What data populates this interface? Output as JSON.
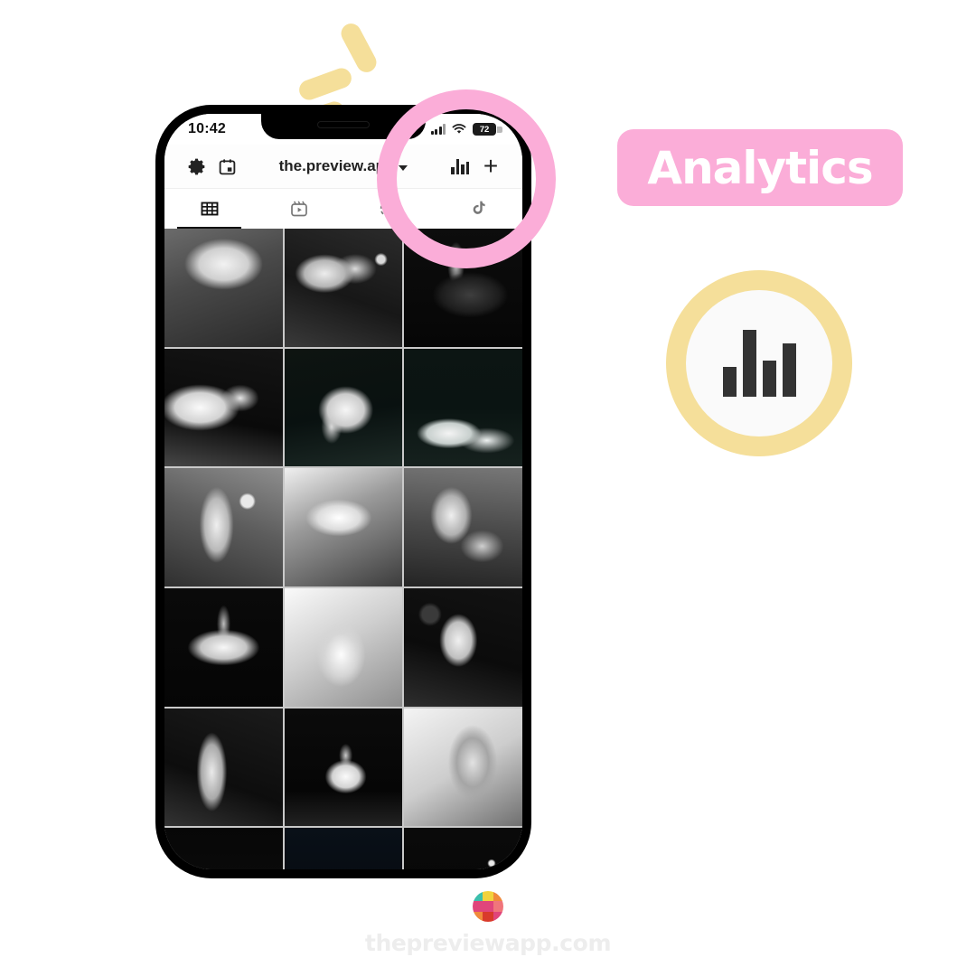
{
  "canvas": {
    "background": "#ffffff",
    "accent_pink": "#FBADD8",
    "accent_yellow": "#F5DF9A",
    "watermark_gray": "#EDEDED"
  },
  "confetti": [
    {
      "name": "confetti-dash-1"
    },
    {
      "name": "confetti-dash-2"
    },
    {
      "name": "confetti-dash-3"
    }
  ],
  "phone": {
    "status_bar": {
      "time": "10:42",
      "signal_icon": "cellular-signal-icon",
      "wifi_icon": "wifi-icon",
      "battery_level": "72"
    },
    "toolbar": {
      "settings_icon": "gear-icon",
      "calendar_icon": "calendar-icon",
      "account_name": "the.preview.app",
      "account_chevron": "chevron-down-icon",
      "analytics_icon": "bar-chart-icon",
      "add_icon": "plus-icon",
      "add_label": "+"
    },
    "tabs": [
      {
        "name": "tab-grid",
        "icon": "grid-icon",
        "active": true
      },
      {
        "name": "tab-reels",
        "icon": "reels-icon",
        "active": false
      },
      {
        "name": "tab-stories",
        "icon": "circle-dashed-icon",
        "active": false
      },
      {
        "name": "tab-tiktok",
        "icon": "tiktok-icon",
        "active": false
      }
    ],
    "grid": {
      "columns": 3,
      "theme": "black-and-white ballet photography",
      "cells": [
        {
          "label": "ballerina in tutu bending forward"
        },
        {
          "label": "row of ballerinas backstage"
        },
        {
          "label": "ballerina in dark tutu on pointe"
        },
        {
          "label": "group of ballerinas in white tutus"
        },
        {
          "label": "pas de deux lift on stage"
        },
        {
          "label": "two white tutus hanging"
        },
        {
          "label": "close-up of pointe shoes on toes"
        },
        {
          "label": "dancer leaping in front of train"
        },
        {
          "label": "two dancers reaching, arabesque"
        },
        {
          "label": "ballerina in wide tutu center stage"
        },
        {
          "label": "close-up of feet in pointe shoes"
        },
        {
          "label": "ballerina arabesque spotlight"
        },
        {
          "label": "dancer legs on pointe against wall"
        },
        {
          "label": "ballerina spinning in long white skirt"
        },
        {
          "label": "pointe shoes pair close-up, light bg"
        },
        {
          "label": "corps de ballet seated on stage"
        },
        {
          "label": "dancers with arms raised, stage lights"
        },
        {
          "label": "corps de ballet in white tutus"
        }
      ]
    }
  },
  "highlight": {
    "name": "analytics-highlight-ring",
    "color": "#FBADD8",
    "target": "analytics-icon"
  },
  "callout": {
    "badge_label": "Analytics",
    "badge_color": "#FBADD8",
    "icon_circle_color": "#F5DF9A",
    "icon_name": "bar-chart-icon"
  },
  "footer": {
    "logo_name": "preview-app-logo",
    "logo_colors": [
      "#3BBFAD",
      "#F2D23C",
      "#F08A3C",
      "#E0457B",
      "#E0457B",
      "#F0757B",
      "#F08A3C",
      "#D93A2B",
      "#E0457B"
    ],
    "website": "thepreviewapp.com"
  }
}
